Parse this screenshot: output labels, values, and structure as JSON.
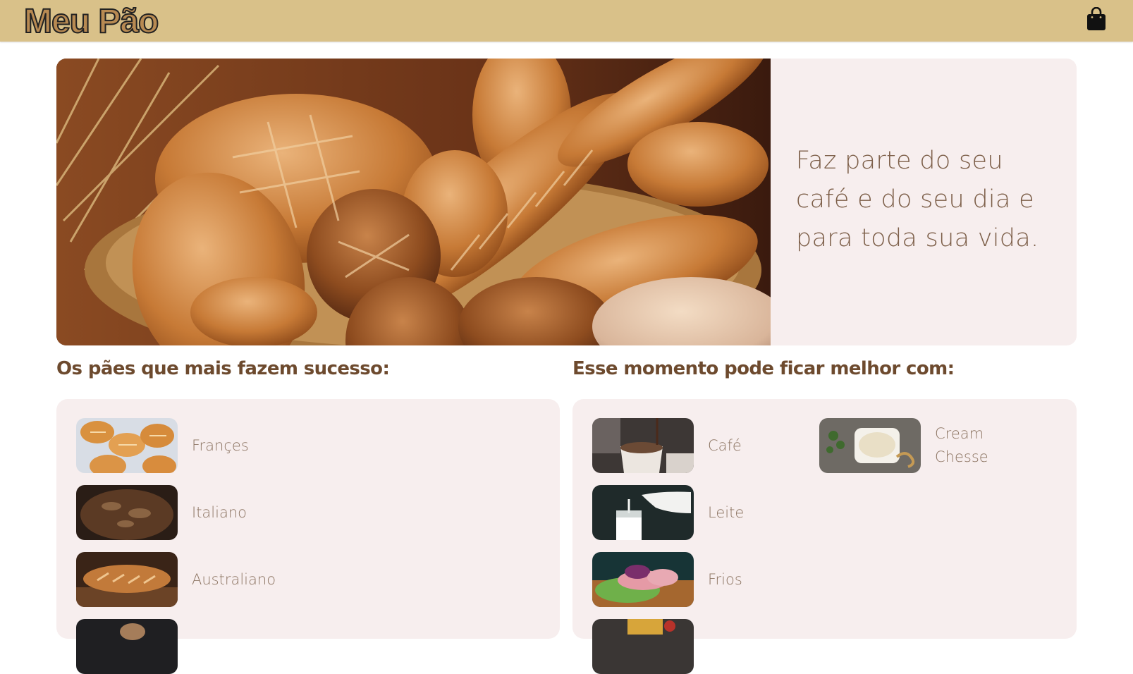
{
  "header": {
    "logo_text": "Meu Pão",
    "bag_icon": "shopping-bag-icon",
    "colors": {
      "bar": "#d9c189",
      "logo_fill": "#b88a52"
    }
  },
  "hero": {
    "image_icon": "bread-basket-photo",
    "tagline": "Faz parte do seu café e do seu dia e para toda sua vida."
  },
  "breads": {
    "title": "Os pães que mais fazem sucesso:",
    "items": [
      {
        "label": "Françes",
        "icon": "french-bread-photo"
      },
      {
        "label": "Italiano",
        "icon": "italian-bread-photo"
      },
      {
        "label": "Australiano",
        "icon": "australian-bread-photo"
      },
      {
        "label": "",
        "icon": "bread-photo"
      }
    ]
  },
  "extras": {
    "title": "Esse momento pode ficar melhor com:",
    "items": [
      {
        "label": "Café",
        "icon": "coffee-photo"
      },
      {
        "label": "Cream Chesse",
        "icon": "cream-cheese-photo"
      },
      {
        "label": "Leite",
        "icon": "milk-photo"
      },
      {
        "label": "Frios",
        "icon": "cold-cuts-photo"
      },
      {
        "label": "",
        "icon": "food-photo"
      }
    ]
  }
}
